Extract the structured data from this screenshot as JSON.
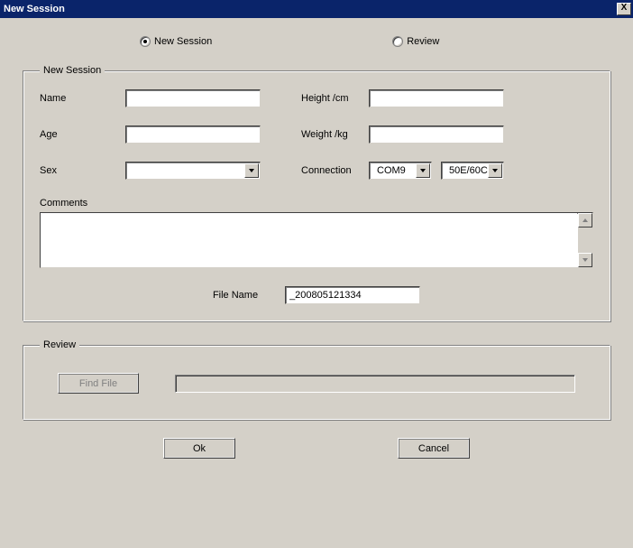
{
  "window": {
    "title": "New Session",
    "close": "X"
  },
  "radios": {
    "new_session": "New Session",
    "review": "Review"
  },
  "groupbox": {
    "new_session_legend": "New Session",
    "review_legend": "Review"
  },
  "labels": {
    "name": "Name",
    "age": "Age",
    "sex": "Sex",
    "height": "Height /cm",
    "weight": "Weight /kg",
    "connection": "Connection",
    "comments": "Comments",
    "file_name": "File Name"
  },
  "fields": {
    "name": "",
    "age": "",
    "sex": "",
    "height": "",
    "weight": "",
    "connection": "COM9",
    "model": "50E/60C",
    "comments": "",
    "file_name": "_200805121334",
    "review_path": ""
  },
  "buttons": {
    "find_file": "Find File",
    "ok": "Ok",
    "cancel": "Cancel"
  }
}
